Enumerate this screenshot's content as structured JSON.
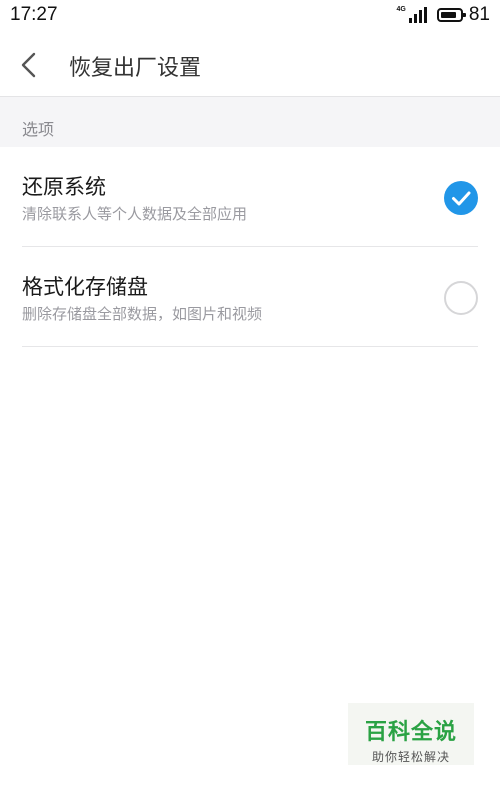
{
  "status_bar": {
    "time": "17:27",
    "network": "4G",
    "battery_level": 0.81,
    "battery_text": "81"
  },
  "header": {
    "back_icon": "chevron-left-icon",
    "title": "恢复出厂设置"
  },
  "section": {
    "label": "选项"
  },
  "options": [
    {
      "title": "还原系统",
      "description": "清除联系人等个人数据及全部应用",
      "checked": true
    },
    {
      "title": "格式化存储盘",
      "description": "删除存储盘全部数据，如图片和视频",
      "checked": false
    }
  ],
  "watermark": {
    "title": "百科全说",
    "subtitle": "助你轻松解决"
  },
  "colors": {
    "accent": "#2196e8",
    "watermark_green": "#2aa244"
  }
}
